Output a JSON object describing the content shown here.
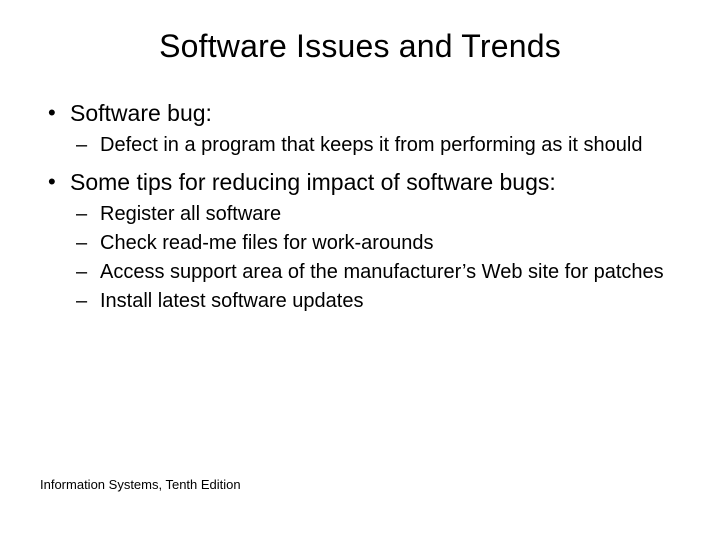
{
  "title": "Software Issues and Trends",
  "bullets": [
    {
      "text": "Software bug:",
      "sub": [
        "Defect in a program that keeps it from performing as it  should"
      ]
    },
    {
      "text": "Some tips for reducing impact of software bugs:",
      "sub": [
        "Register all software",
        "Check read-me files for work-arounds",
        "Access support area of the manufacturer’s Web site for patches",
        "Install latest software updates"
      ]
    }
  ],
  "footer": "Information Systems, Tenth Edition"
}
